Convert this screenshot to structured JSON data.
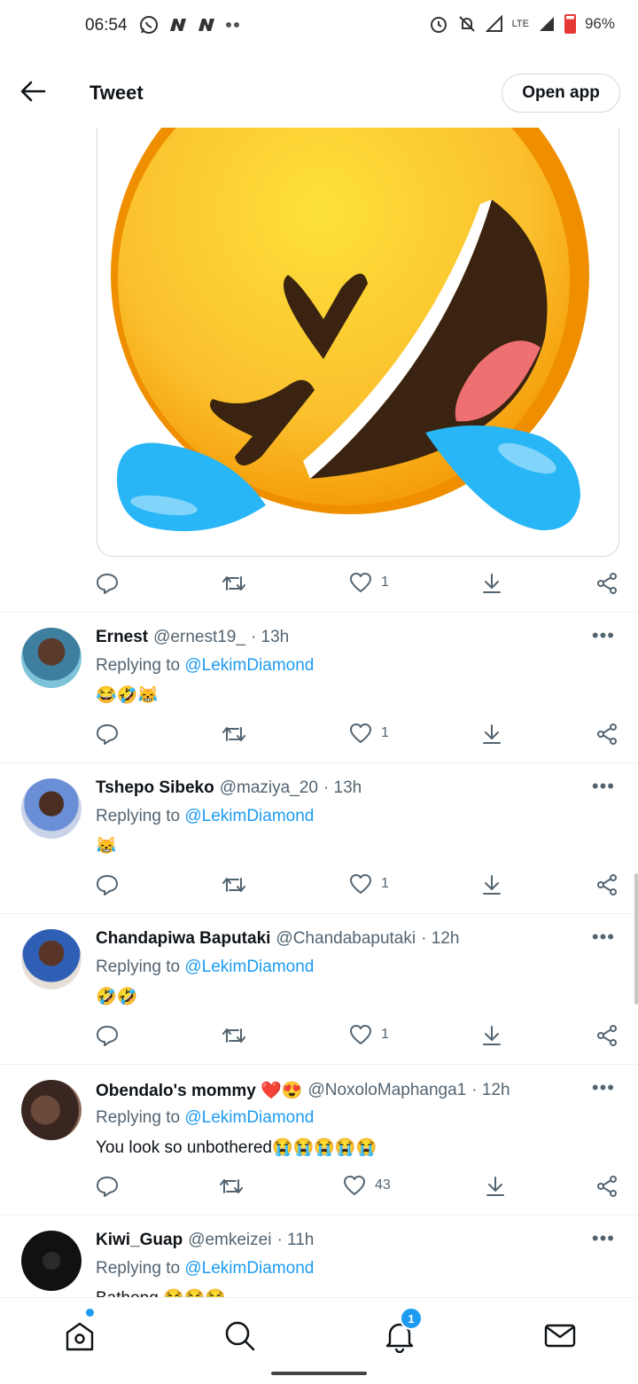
{
  "status_bar": {
    "time": "06:54",
    "left_icons": [
      "whatsapp-icon",
      "n-icon",
      "n-icon",
      "more-dots-icon"
    ],
    "network": "LTE",
    "battery": "96%"
  },
  "header": {
    "title": "Tweet",
    "open_app_label": "Open app"
  },
  "main_tweet": {
    "media": "rolling-on-floor-laughing-emoji",
    "actions": {
      "reply_count": "",
      "retweet_count": "",
      "like_count": "1"
    }
  },
  "replies": [
    {
      "name": "Ernest",
      "handle": "@ernest19_",
      "time": "· 13h",
      "replying_prefix": "Replying to ",
      "replying_to": "@LekimDiamond",
      "text": "😂🤣😹",
      "like_count": "1"
    },
    {
      "name": "Tshepo Sibeko",
      "handle": "@maziya_20",
      "time": "· 13h",
      "replying_prefix": "Replying to ",
      "replying_to": "@LekimDiamond",
      "text": "😹",
      "like_count": "1"
    },
    {
      "name": "Chandapiwa Baputaki",
      "handle": "@Chandabaputaki",
      "time": "· 12h",
      "replying_prefix": "Replying to ",
      "replying_to": "@LekimDiamond",
      "text": "🤣🤣",
      "like_count": "1"
    },
    {
      "name": "Obendalo's mommy ❤️😍",
      "handle": "@NoxoloMaphanga1",
      "time": "· 12h",
      "replying_prefix": "Replying to ",
      "replying_to": "@LekimDiamond",
      "text": "You look so unbothered😭😭😭😭😭",
      "like_count": "43"
    },
    {
      "name": "Kiwi_Guap",
      "handle": "@emkeizei",
      "time": "· 11h",
      "replying_prefix": "Replying to ",
      "replying_to": "@LekimDiamond",
      "text": "Bathong 😂😂😂",
      "like_count": ""
    }
  ],
  "bottom_nav": {
    "items": [
      "home-icon",
      "search-icon",
      "notifications-icon",
      "messages-icon"
    ],
    "notification_badge": "1"
  },
  "colors": {
    "accent": "#1d9bf0",
    "secondary_text": "#536471",
    "divider": "#eff3f4"
  }
}
